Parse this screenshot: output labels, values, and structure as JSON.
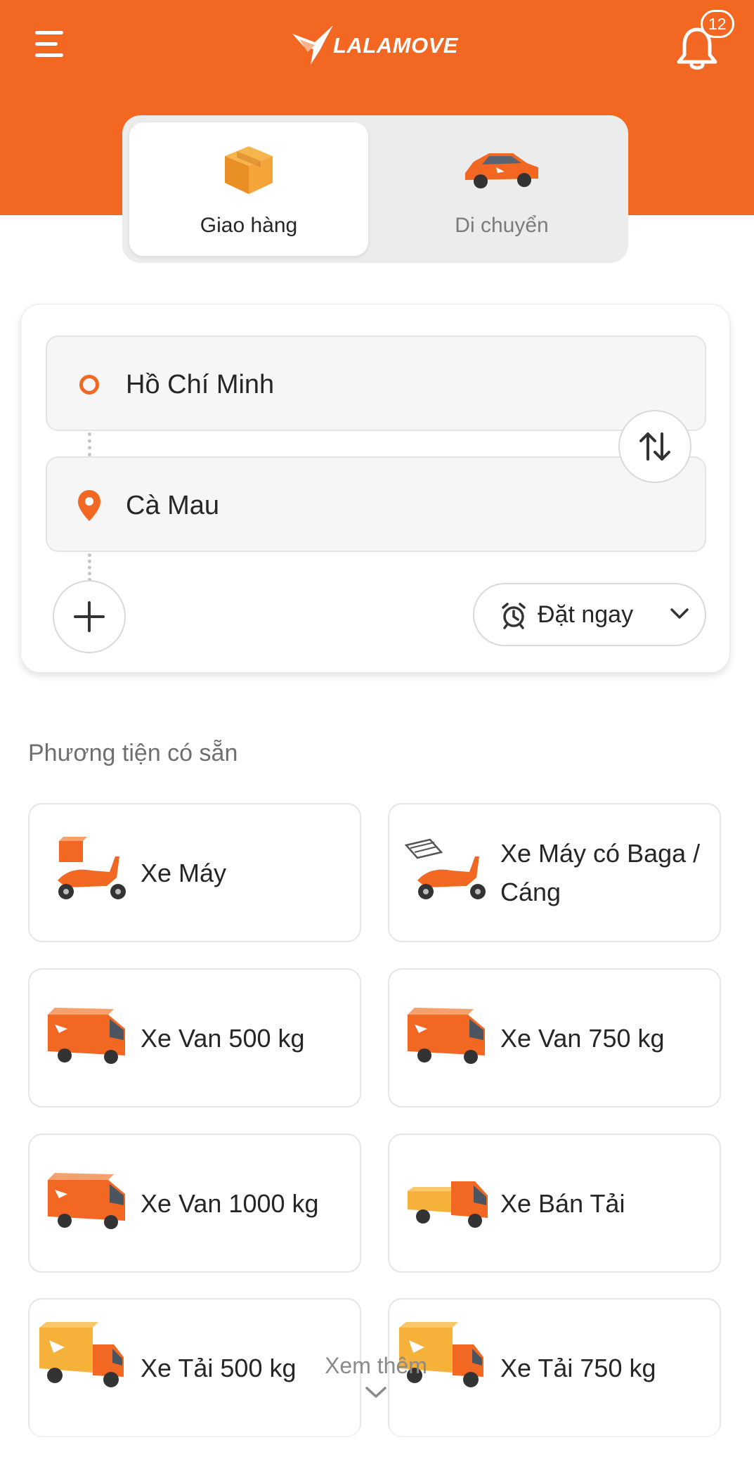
{
  "app": {
    "brand": "LALAMOVE",
    "notification_count": "12"
  },
  "colors": {
    "accent": "#f26722",
    "card_border": "#e6e6e6"
  },
  "service_tabs": [
    {
      "label": "Giao hàng",
      "icon": "box-icon",
      "active": true
    },
    {
      "label": "Di chuyển",
      "icon": "car-icon",
      "active": false
    }
  ],
  "route": {
    "origin": "Hồ Chí Minh",
    "destination": "Cà Mau",
    "schedule_label": "Đặt ngay"
  },
  "vehicles": {
    "title": "Phương tiện có sẵn",
    "items": [
      {
        "label": "Xe Máy",
        "icon": "motorbike-icon"
      },
      {
        "label": "Xe Máy có Baga / Cáng",
        "icon": "motorbike-rack-icon"
      },
      {
        "label": "Xe Van 500 kg",
        "icon": "van-icon"
      },
      {
        "label": "Xe Van 750 kg",
        "icon": "van-icon"
      },
      {
        "label": "Xe Van 1000 kg",
        "icon": "van-icon"
      },
      {
        "label": "Xe Bán Tải",
        "icon": "pickup-truck-icon"
      },
      {
        "label": "Xe Tải 500 kg",
        "icon": "truck-icon"
      },
      {
        "label": "Xe Tải 750 kg",
        "icon": "truck-icon"
      }
    ]
  },
  "see_more": {
    "label": "Xem thêm"
  }
}
